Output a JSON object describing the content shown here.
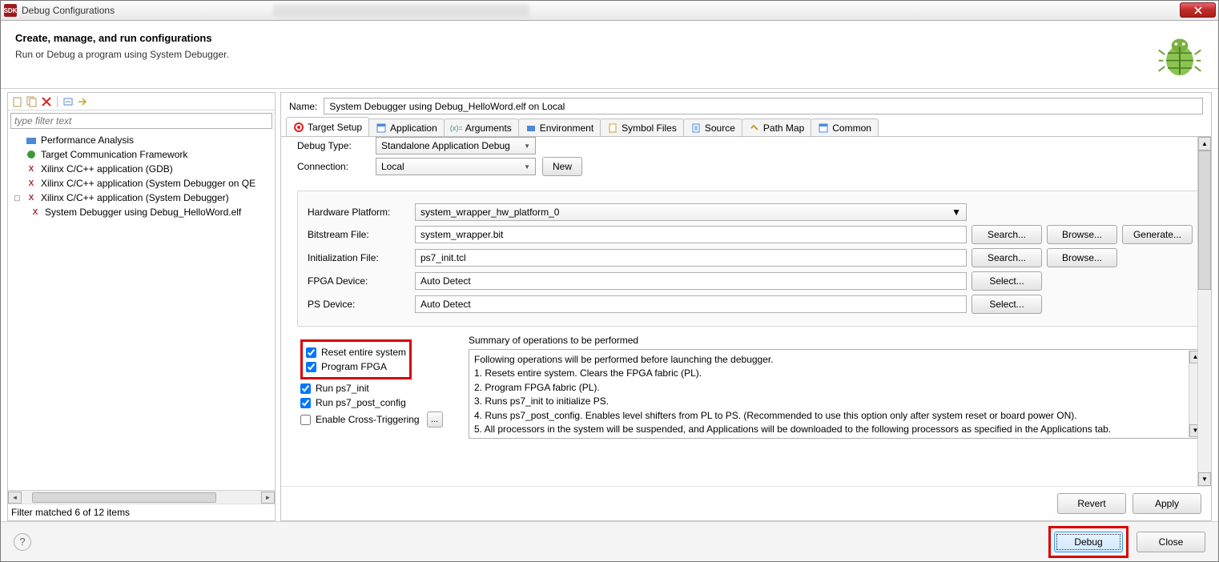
{
  "window_title": "Debug Configurations",
  "header": {
    "title": "Create, manage, and run configurations",
    "subtitle": "Run or Debug a program using System Debugger."
  },
  "left": {
    "filter_placeholder": "type filter text",
    "items": [
      "Performance Analysis",
      "Target Communication Framework",
      "Xilinx C/C++ application (GDB)",
      "Xilinx C/C++ application (System Debugger on QE",
      "Xilinx C/C++ application (System Debugger)"
    ],
    "child": "System Debugger using Debug_HelloWord.elf ",
    "filter_status": "Filter matched 6 of 12 items"
  },
  "name_label": "Name:",
  "name_value": "System Debugger using Debug_HelloWord.elf on Local",
  "tabs": [
    "Target Setup",
    "Application",
    "Arguments",
    "Environment",
    "Symbol Files",
    "Source",
    "Path Map",
    "Common"
  ],
  "debug_type_label": "Debug Type:",
  "debug_type_value": "Standalone Application Debug",
  "connection_label": "Connection:",
  "connection_value": "Local",
  "new_btn": "New",
  "hw": {
    "platform_label": "Hardware Platform:",
    "platform_value": "system_wrapper_hw_platform_0",
    "bitstream_label": "Bitstream File:",
    "bitstream_value": "system_wrapper.bit",
    "init_label": "Initialization File:",
    "init_value": "ps7_init.tcl",
    "fpga_label": "FPGA Device:",
    "fpga_value": "Auto Detect",
    "ps_label": "PS Device:",
    "ps_value": "Auto Detect",
    "search": "Search...",
    "browse": "Browse...",
    "generate": "Generate...",
    "select": "Select..."
  },
  "checks": {
    "reset": "Reset entire system",
    "program": "Program FPGA",
    "runinit": "Run ps7_init",
    "runpost": "Run ps7_post_config",
    "cross": "Enable Cross-Triggering"
  },
  "summary": {
    "title": "Summary of operations to be performed",
    "lines": [
      "Following operations will be performed before launching the debugger.",
      "1. Resets entire system. Clears the FPGA fabric (PL).",
      "2. Program FPGA fabric (PL).",
      "3. Runs ps7_init to initialize PS.",
      "4. Runs ps7_post_config. Enables level shifters from PL to PS. (Recommended to use this option only after system reset or board power ON).",
      "5. All processors in the system will be suspended, and Applications will be downloaded to the following processors as specified in the Applications tab."
    ]
  },
  "revert": "Revert",
  "apply": "Apply",
  "debug": "Debug",
  "close": "Close"
}
